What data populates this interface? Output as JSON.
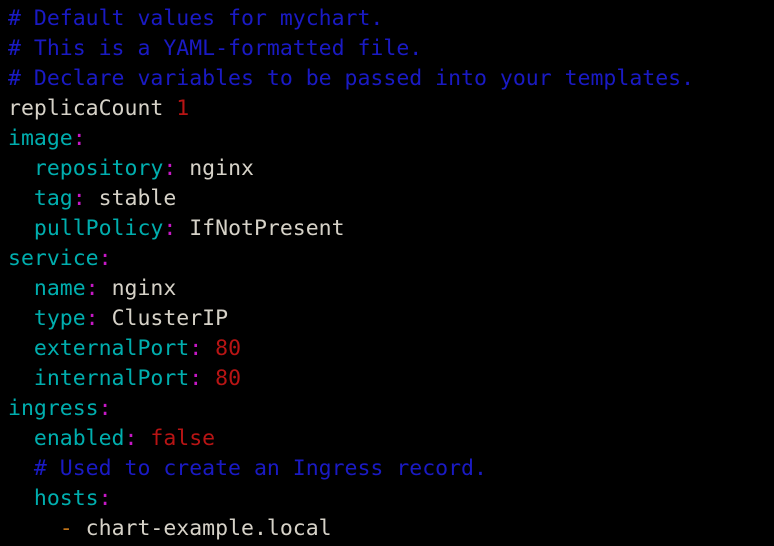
{
  "editor": {
    "language": "yaml",
    "background": "#000000",
    "font_size_px": 21.5,
    "line_height_px": 30,
    "colors": {
      "comment": "#1a1ac4",
      "key": "#00aeae",
      "colon": "#c618c6",
      "value": "#d6d2c8",
      "number": "#b81414",
      "boolean": "#b81414",
      "list_dash": "#c07318",
      "plain_text": "#d6d2c8"
    },
    "lines": [
      {
        "id": "line-1",
        "indent": "",
        "tokens": [
          {
            "type": "comment",
            "text": "# Default values for mychart."
          }
        ]
      },
      {
        "id": "line-2",
        "indent": "",
        "tokens": [
          {
            "type": "comment",
            "text": "# This is a YAML-formatted file."
          }
        ]
      },
      {
        "id": "line-3",
        "indent": "",
        "tokens": [
          {
            "type": "comment",
            "text": "# Declare variables to be passed into your templates."
          }
        ]
      },
      {
        "id": "line-4",
        "indent": "",
        "tokens": [
          {
            "type": "plain",
            "text": "replicaCount"
          },
          {
            "type": "plain",
            "text": " "
          },
          {
            "type": "num",
            "text": "1"
          }
        ]
      },
      {
        "id": "line-5",
        "indent": "",
        "tokens": [
          {
            "type": "key",
            "text": "image"
          },
          {
            "type": "colon",
            "text": ":"
          }
        ]
      },
      {
        "id": "line-6",
        "indent": "  ",
        "tokens": [
          {
            "type": "key",
            "text": "repository"
          },
          {
            "type": "colon",
            "text": ":"
          },
          {
            "type": "value",
            "text": " nginx"
          }
        ]
      },
      {
        "id": "line-7",
        "indent": "  ",
        "tokens": [
          {
            "type": "key",
            "text": "tag"
          },
          {
            "type": "colon",
            "text": ":"
          },
          {
            "type": "value",
            "text": " stable"
          }
        ]
      },
      {
        "id": "line-8",
        "indent": "  ",
        "tokens": [
          {
            "type": "key",
            "text": "pullPolicy"
          },
          {
            "type": "colon",
            "text": ":"
          },
          {
            "type": "value",
            "text": " IfNotPresent"
          }
        ]
      },
      {
        "id": "line-9",
        "indent": "",
        "tokens": [
          {
            "type": "key",
            "text": "service"
          },
          {
            "type": "colon",
            "text": ":"
          }
        ]
      },
      {
        "id": "line-10",
        "indent": "  ",
        "tokens": [
          {
            "type": "key",
            "text": "name"
          },
          {
            "type": "colon",
            "text": ":"
          },
          {
            "type": "value",
            "text": " nginx"
          }
        ]
      },
      {
        "id": "line-11",
        "indent": "  ",
        "tokens": [
          {
            "type": "key",
            "text": "type"
          },
          {
            "type": "colon",
            "text": ":"
          },
          {
            "type": "value",
            "text": " ClusterIP"
          }
        ]
      },
      {
        "id": "line-12",
        "indent": "  ",
        "tokens": [
          {
            "type": "key",
            "text": "externalPort"
          },
          {
            "type": "colon",
            "text": ":"
          },
          {
            "type": "num",
            "text": " 80"
          }
        ]
      },
      {
        "id": "line-13",
        "indent": "  ",
        "tokens": [
          {
            "type": "key",
            "text": "internalPort"
          },
          {
            "type": "colon",
            "text": ":"
          },
          {
            "type": "num",
            "text": " 80"
          }
        ]
      },
      {
        "id": "line-14",
        "indent": "",
        "tokens": [
          {
            "type": "key",
            "text": "ingress"
          },
          {
            "type": "colon",
            "text": ":"
          }
        ]
      },
      {
        "id": "line-15",
        "indent": "  ",
        "tokens": [
          {
            "type": "key",
            "text": "enabled"
          },
          {
            "type": "colon",
            "text": ":"
          },
          {
            "type": "bool",
            "text": " false"
          }
        ]
      },
      {
        "id": "line-16",
        "indent": "  ",
        "tokens": [
          {
            "type": "comment",
            "text": "# Used to create an Ingress record."
          }
        ]
      },
      {
        "id": "line-17",
        "indent": "  ",
        "tokens": [
          {
            "type": "key",
            "text": "hosts"
          },
          {
            "type": "colon",
            "text": ":"
          }
        ]
      },
      {
        "id": "line-18",
        "indent": "    ",
        "tokens": [
          {
            "type": "dash",
            "text": "-"
          },
          {
            "type": "value",
            "text": " chart-example.local"
          }
        ]
      }
    ]
  }
}
